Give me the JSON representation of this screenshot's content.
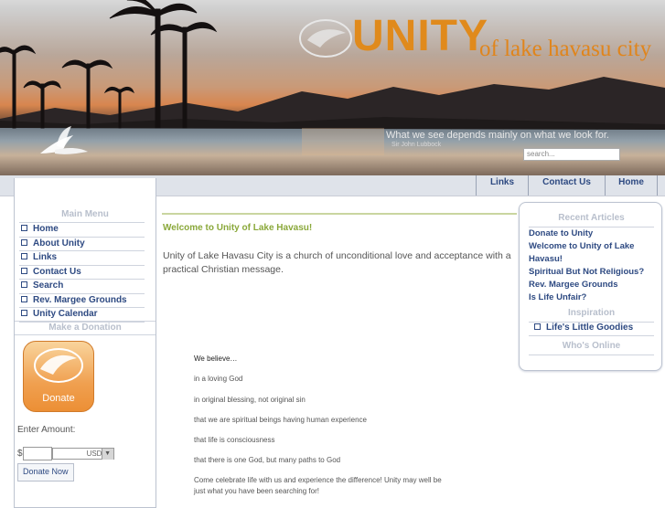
{
  "header": {
    "logo_main": "UNITY",
    "logo_sub": "of lake havasu city",
    "quote": "What we see depends mainly on what we look for.",
    "quote_author": "Sir John Lubbock",
    "search_placeholder": "search..."
  },
  "nav": {
    "items": [
      "Links",
      "Contact Us",
      "Home"
    ]
  },
  "left": {
    "main_menu_title": "Main Menu",
    "menu": [
      "Home",
      "About Unity",
      "Links",
      "Contact Us",
      "Search",
      "Rev. Margee Grounds",
      "Unity Calendar"
    ],
    "donation_title": "Make a Donation",
    "donate_label": "Donate",
    "amount_label": "Enter Amount:",
    "currency_symbol": "$",
    "currency": "USD",
    "donate_now": "Donate Now"
  },
  "main": {
    "title": "Welcome to Unity of Lake Havasu!",
    "intro": "Unity of Lake Havasu City is a church of unconditional love and acceptance with a practical Christian message.",
    "believe": [
      "We believe…",
      "in a loving God",
      "in original blessing, not original sin",
      "that we are spiritual beings having human experience",
      "that life is consciousness",
      "that there is one God, but many paths to God",
      "Come celebrate life with us and experience the difference! Unity may well be",
      "just what you have been searching for!"
    ]
  },
  "right": {
    "recent_title": "Recent Articles",
    "articles": [
      "Donate to Unity",
      "Welcome to Unity of Lake Havasu!",
      "Spiritual But Not Religious?",
      "Rev. Margee Grounds",
      "Is Life Unfair?"
    ],
    "inspiration_title": "Inspiration",
    "inspiration_items": [
      "Life's Little Goodies"
    ],
    "online_title": "Who's Online"
  },
  "colors": {
    "link": "#2e4a82",
    "accent_orange": "#e08a1c",
    "accent_green": "#8aa83a"
  },
  "icons": [
    "dove-icon",
    "donate-dove-icon",
    "bullet-box-icon",
    "dropdown-arrow-icon"
  ]
}
